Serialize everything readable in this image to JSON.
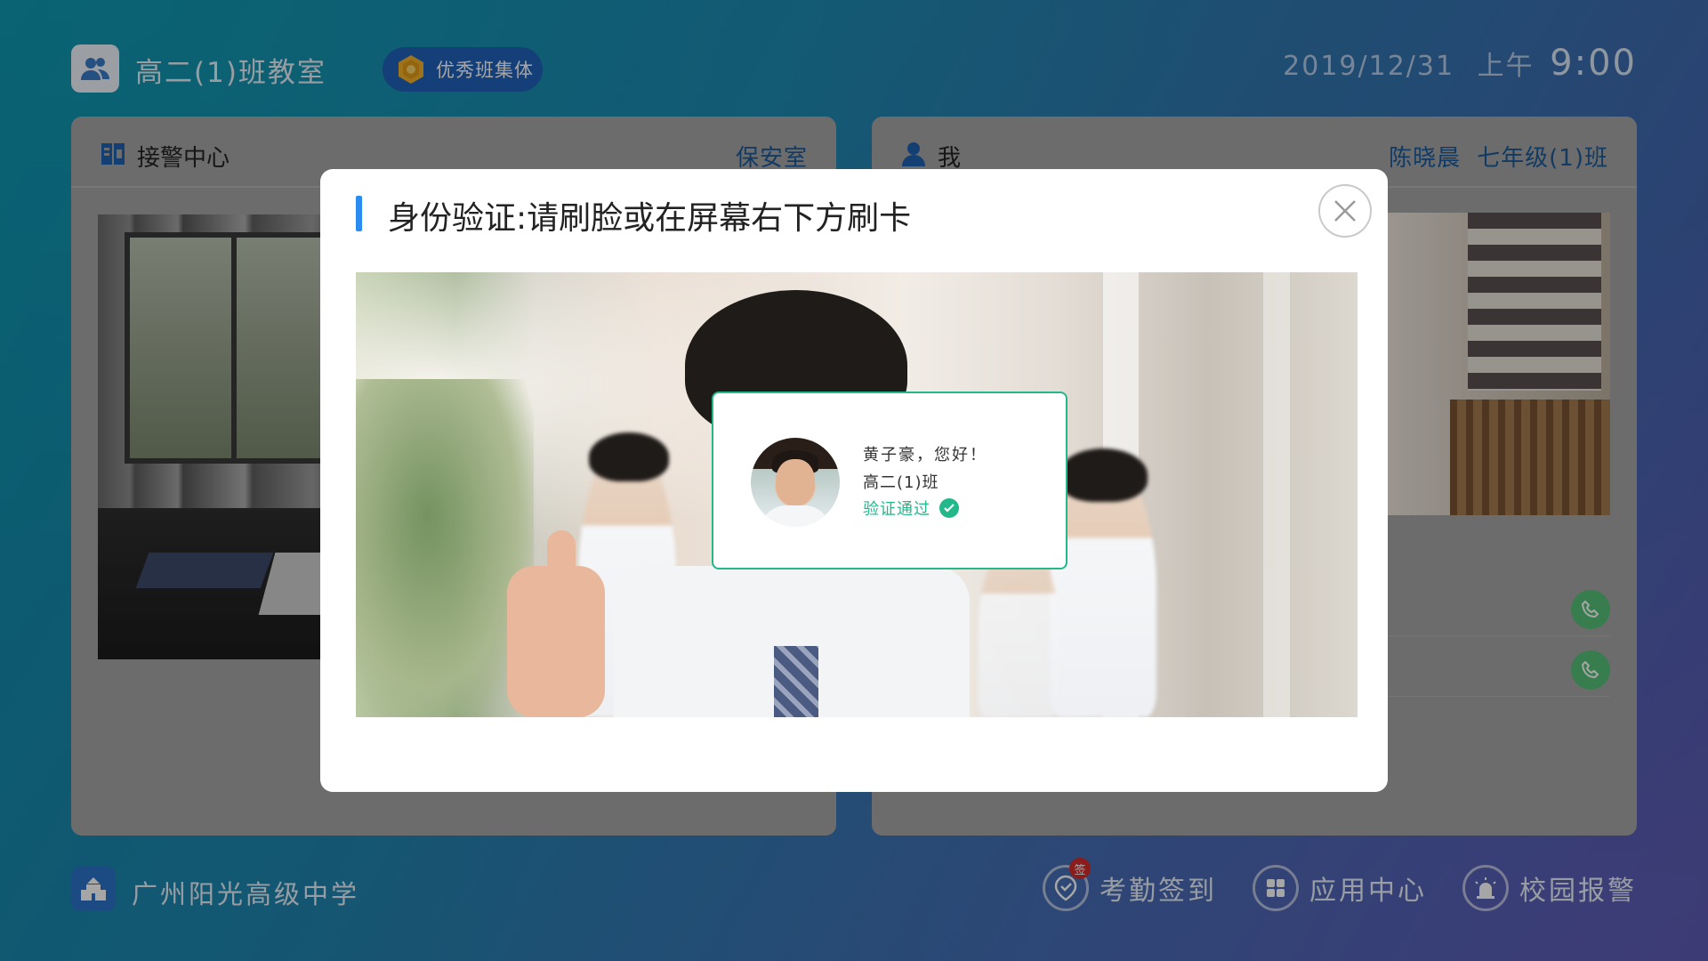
{
  "header": {
    "class_name": "高二(1)班教室",
    "honor_badge": "优秀班集体",
    "date": "2019/12/31",
    "period": "上午",
    "time": "9:00"
  },
  "left_panel": {
    "title": "接警中心",
    "right_label": "保安室"
  },
  "right_panel": {
    "title": "我",
    "user_name": "陈晓晨",
    "user_class": "七年级(1)班"
  },
  "footer": {
    "school_name": "广州阳光高级中学",
    "actions": [
      {
        "label": "考勤签到",
        "icon": "location-check-icon",
        "badge": "签"
      },
      {
        "label": "应用中心",
        "icon": "apps-grid-icon"
      },
      {
        "label": "校园报警",
        "icon": "alarm-light-icon"
      }
    ]
  },
  "modal": {
    "title": "身份验证:请刷脸或在屏幕右下方刷卡",
    "result": {
      "greeting": "黄子豪，您好！",
      "class": "高二(1)班",
      "status": "验证通过"
    }
  },
  "colors": {
    "accent": "#2a8cf0",
    "success": "#23b88a",
    "call_green": "#55c079",
    "badge_red": "#d42b2b"
  }
}
